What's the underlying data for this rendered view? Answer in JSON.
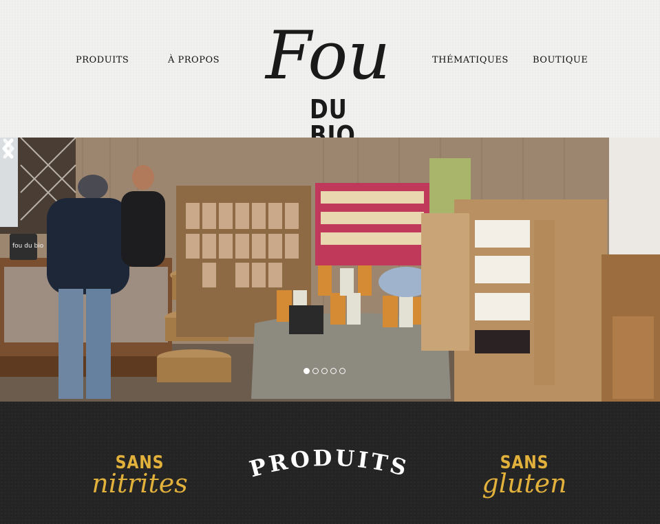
{
  "nav": {
    "produits": "PRODUITS",
    "apropos": "À PROPOS",
    "thematiques": "THÉMATIQUES",
    "boutique": "BOUTIQUE"
  },
  "logo": {
    "script": "Fou",
    "sub": "DU BIO"
  },
  "carousel": {
    "slides": 5,
    "active_index": 0,
    "sign_text": "fou du bio"
  },
  "band": {
    "left_top": "SANS",
    "left_bottom": "nitrites",
    "center": "PRODUITS",
    "right_top": "SANS",
    "right_bottom": "gluten"
  },
  "colors": {
    "accent_gold": "#e2b13c",
    "band_bg": "#242424",
    "header_bg": "#f0f0ee"
  }
}
